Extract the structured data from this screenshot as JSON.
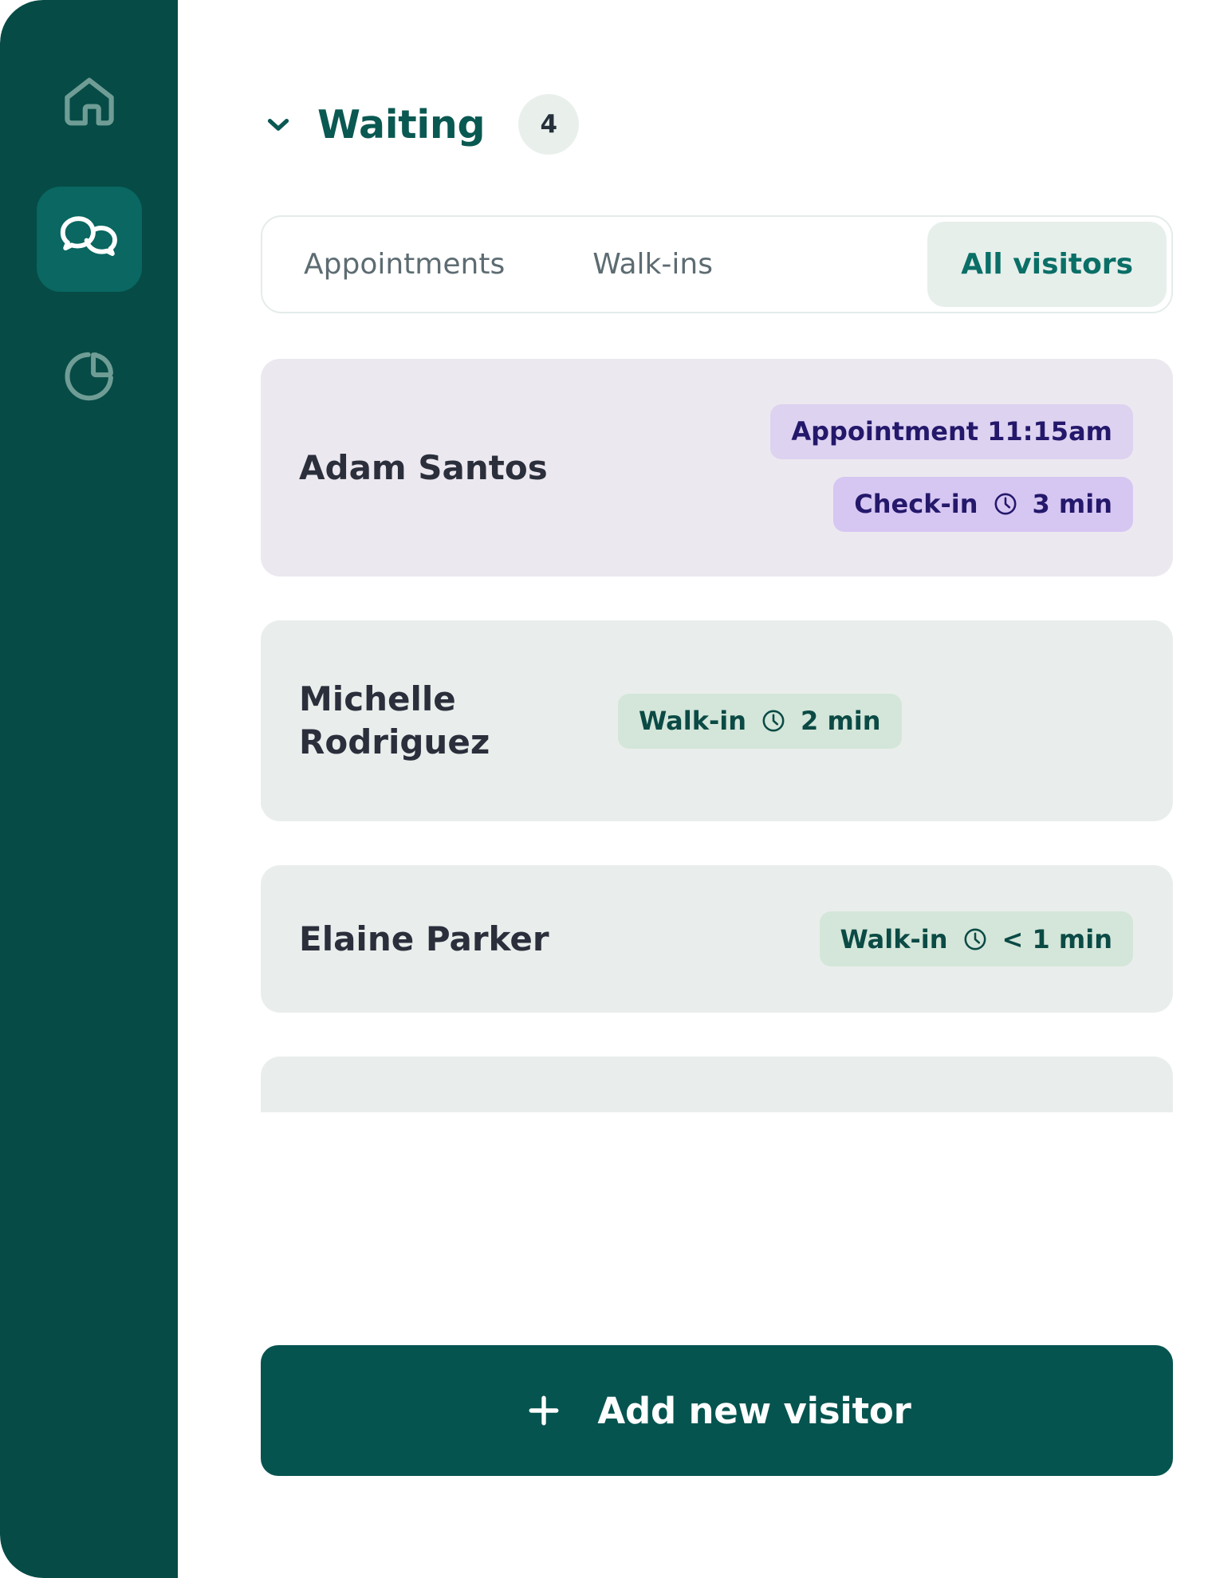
{
  "sidebar": {
    "items": [
      {
        "icon": "home-icon",
        "active": false
      },
      {
        "icon": "chat-bubbles-icon",
        "active": true
      },
      {
        "icon": "pie-chart-icon",
        "active": false
      }
    ]
  },
  "header": {
    "title": "Waiting",
    "count": "4",
    "chevron_icon": "chevron-down-icon"
  },
  "tabs": [
    {
      "label": "Appointments",
      "selected": false
    },
    {
      "label": "Walk-ins",
      "selected": false
    },
    {
      "label": "All visitors",
      "selected": true
    }
  ],
  "visitors": [
    {
      "name": "Adam Santos",
      "type": "appointment",
      "badges": [
        {
          "label": "Appointment 11:15am",
          "style": "purple",
          "clock": false,
          "time": ""
        },
        {
          "label": "Check-in",
          "style": "purple-dark",
          "clock": true,
          "time": "3 min"
        }
      ]
    },
    {
      "name": "Michelle Rodriguez",
      "type": "walkin",
      "badges": [
        {
          "label": "Walk-in",
          "style": "green",
          "clock": true,
          "time": "2 min"
        }
      ]
    },
    {
      "name": "Elaine Parker",
      "type": "walkin",
      "badges": [
        {
          "label": "Walk-in",
          "style": "green",
          "clock": true,
          "time": "< 1 min"
        }
      ]
    }
  ],
  "add_button": {
    "label": "Add new visitor",
    "icon": "plus-icon"
  },
  "colors": {
    "sidebar_bg": "#064b46",
    "sidebar_active": "#0a6761",
    "accent_teal": "#0a5852",
    "appointment_card": "#ece8ef",
    "walkin_card": "#e9eeec",
    "badge_purple": "#ddd2f0",
    "badge_purple_dark": "#d6c6f2",
    "badge_purple_text": "#24186b",
    "badge_green": "#d3e6d9",
    "badge_green_text": "#0b4a45",
    "button_bg": "#065450"
  }
}
